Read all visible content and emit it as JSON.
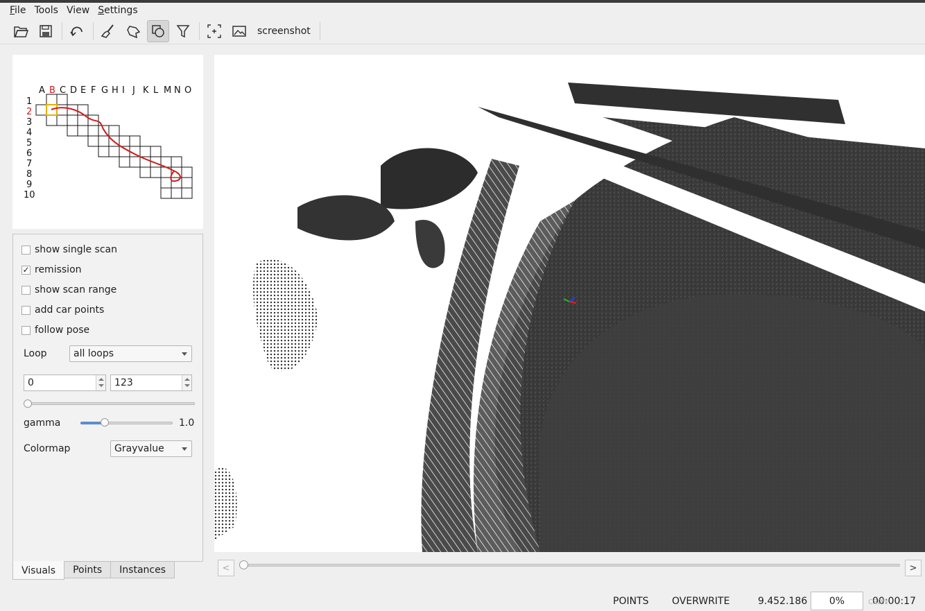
{
  "menubar": {
    "items": [
      {
        "first": "F",
        "rest": "ile"
      },
      {
        "first": "",
        "rest": "Tools"
      },
      {
        "first": "",
        "rest": "View"
      },
      {
        "first": "S",
        "rest": "ettings"
      }
    ]
  },
  "toolbar": {
    "screenshot_label": "screenshot",
    "icons": [
      "open-folder-icon",
      "save-icon",
      "undo-icon",
      "brush-icon",
      "polygon-icon",
      "cylinder-icon",
      "filter-icon",
      "crosshair-icon",
      "image-icon"
    ],
    "active_icon": "cylinder-icon"
  },
  "minimap": {
    "columns": [
      "A",
      "B",
      "C",
      "D",
      "E",
      "F",
      "G",
      "H",
      "I",
      "J",
      "K",
      "L",
      "M",
      "N",
      "O"
    ],
    "rows": [
      "1",
      "2",
      "3",
      "4",
      "5",
      "6",
      "7",
      "8",
      "9",
      "10"
    ],
    "highlight_column": "B",
    "highlight_row": "2",
    "highlight_color": "#e8b000",
    "trajectory_color": "#d01a1a"
  },
  "options": {
    "show_single_scan": {
      "label": "show single scan",
      "checked": false
    },
    "remission": {
      "label": "remission",
      "checked": true
    },
    "show_scan_range": {
      "label": "show scan range",
      "checked": false
    },
    "add_car_points": {
      "label": "add car points",
      "checked": false
    },
    "follow_pose": {
      "label": "follow pose",
      "checked": false
    },
    "loop_label": "Loop",
    "loop_value": "all loops",
    "range_start": "0",
    "range_end": "123",
    "range_slider_fraction": 0.0,
    "gamma_label": "gamma",
    "gamma_value": "1.0",
    "gamma_slider_fraction": 0.24,
    "colormap_label": "Colormap",
    "colormap_value": "Grayvalue"
  },
  "tabs": [
    {
      "label": "Visuals",
      "active": true
    },
    {
      "label": "Points",
      "active": false
    },
    {
      "label": "Instances",
      "active": false
    }
  ],
  "timeline": {
    "prev_label": "<",
    "next_label": ">",
    "position_fraction": 0.0
  },
  "status": {
    "mode": "POINTS",
    "write_mode": "OVERWRITE",
    "point_count": "9.452.186",
    "percent": "0%",
    "time": "00:00:17"
  },
  "watermark": "CSDN"
}
